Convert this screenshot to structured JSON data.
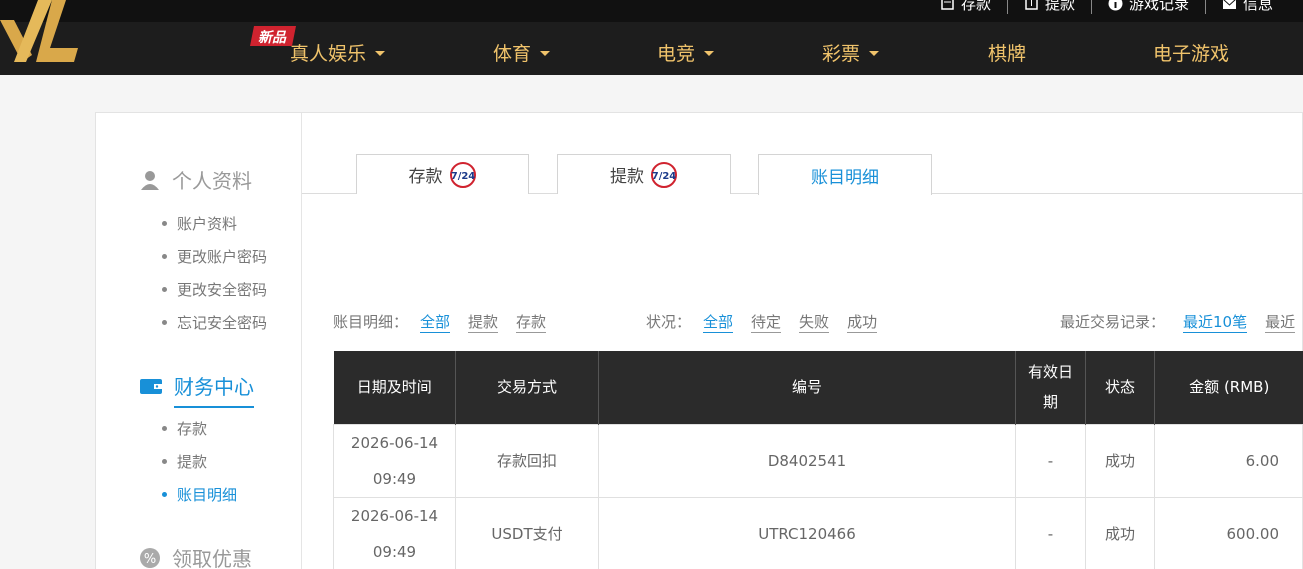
{
  "header": {
    "top_links": [
      {
        "label": "存款",
        "icon": "card-icon"
      },
      {
        "label": "提款",
        "icon": "withdraw-icon"
      },
      {
        "label": "游戏记录",
        "icon": "info-icon"
      },
      {
        "label": "信息",
        "icon": "mail-icon"
      }
    ],
    "new_badge": "新品",
    "nav": [
      {
        "label": "真人娱乐",
        "dropdown": true
      },
      {
        "label": "体育",
        "dropdown": true
      },
      {
        "label": "电竞",
        "dropdown": true
      },
      {
        "label": "彩票",
        "dropdown": true
      },
      {
        "label": "棋牌",
        "dropdown": false
      },
      {
        "label": "电子游戏",
        "dropdown": false
      }
    ],
    "accent": "#f0c36b"
  },
  "sidebar": {
    "sections": [
      {
        "title": "个人资料",
        "icon": "user-icon",
        "items": [
          "账户资料",
          "更改账户密码",
          "更改安全密码",
          "忘记安全密码"
        ]
      },
      {
        "title": "财务中心",
        "icon": "wallet-icon",
        "items": [
          "存款",
          "提款",
          "账目明细"
        ]
      },
      {
        "title": "领取优惠",
        "icon": "percent-icon",
        "items": []
      }
    ],
    "active_section": "财务中心",
    "active_item": "账目明细",
    "badge_text": "7/24"
  },
  "tabs": [
    {
      "label": "存款",
      "badge": true
    },
    {
      "label": "提款",
      "badge": true
    },
    {
      "label": "账目明细",
      "badge": false,
      "active": true
    }
  ],
  "filters": {
    "type_label": "账目明细：",
    "type_options": [
      "全部",
      "提款",
      "存款"
    ],
    "type_selected": "全部",
    "status_label": "状况：",
    "status_options": [
      "全部",
      "待定",
      "失败",
      "成功"
    ],
    "status_selected": "全部",
    "recent_label": "最近交易记录：",
    "recent_options": [
      "最近10笔",
      "最近"
    ],
    "recent_selected": "最近10笔"
  },
  "table": {
    "headers": [
      "日期及时间",
      "交易方式",
      "编号",
      "有效日期",
      "状态",
      "金额 (RMB)"
    ],
    "rows": [
      {
        "date": "2026-06-14",
        "time": "09:49",
        "method": "存款回扣",
        "id": "D8402541",
        "valid": "-",
        "status": "成功",
        "amount": "6.00"
      },
      {
        "date": "2026-06-14",
        "time": "09:49",
        "method": "USDT支付",
        "id": "UTRC120466",
        "valid": "-",
        "status": "成功",
        "amount": "600.00"
      }
    ]
  },
  "colors": {
    "primary": "#1890d8",
    "header_bg": "#1d1d1d",
    "table_head_bg": "#2b2b2b"
  }
}
